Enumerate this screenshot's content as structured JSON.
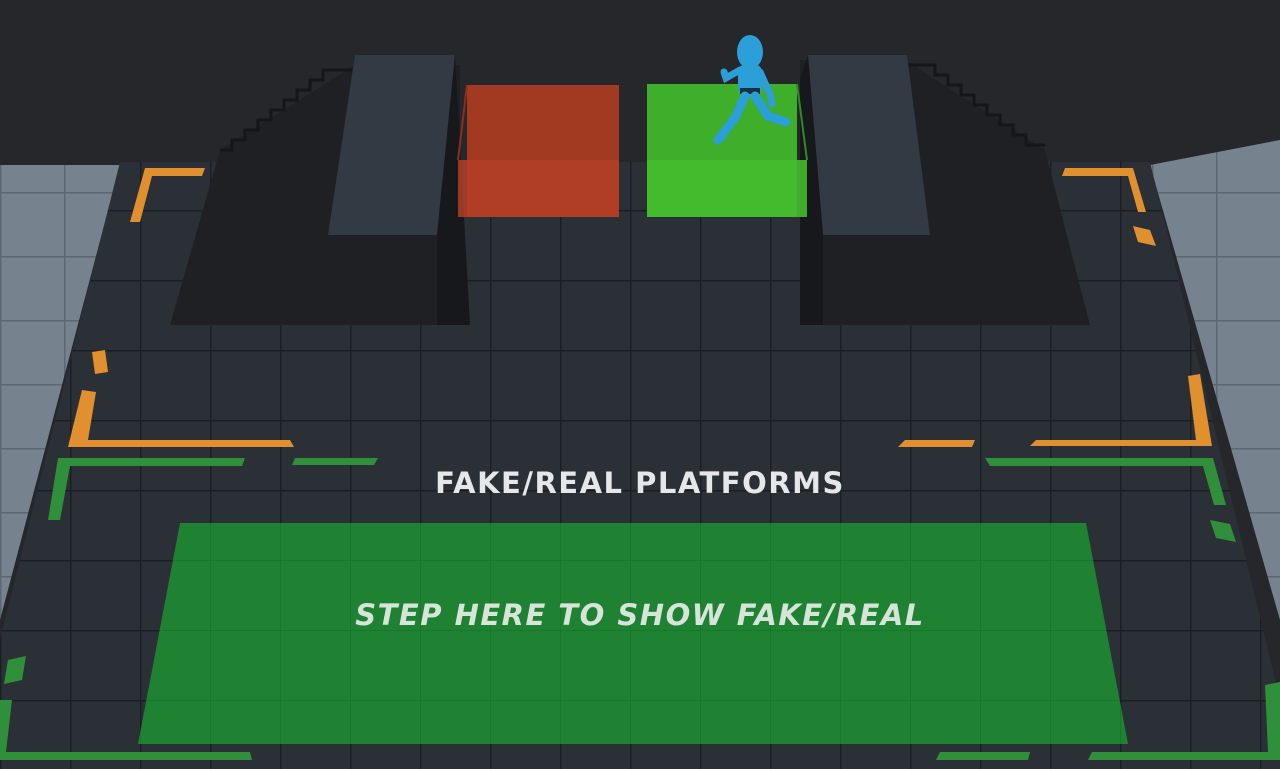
{
  "scene": {
    "section_title": "FAKE/REAL PLATFORMS",
    "pad_label": "STEP HERE TO SHOW FAKE/REAL"
  },
  "colors": {
    "background": "#26272b",
    "floor": "#2b3036",
    "floor_grid": "#1c2025",
    "side_floor": "#76838f",
    "stair_block": "#1f2024",
    "pillar_top": "#323a43",
    "fake_platform": "#a23a22",
    "real_platform": "#3fae2a",
    "step_pad": "#1d8a32",
    "bracket_orange": "#e0902f",
    "bracket_green": "#2f8f3a",
    "player": "#2a9fd8"
  }
}
